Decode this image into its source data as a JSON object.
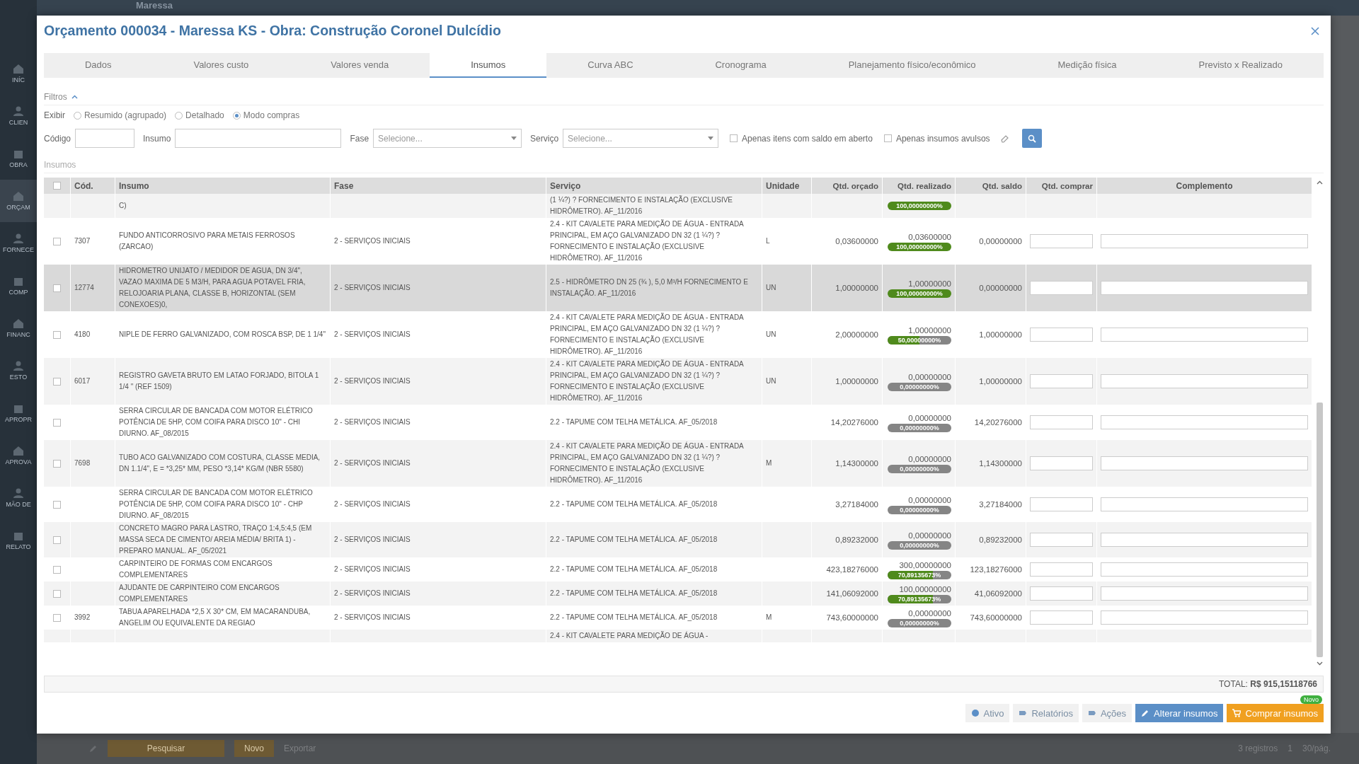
{
  "background": {
    "brand": "Maressa",
    "sidebar_items": [
      {
        "label": "INÍC",
        "selected": false
      },
      {
        "label": "CLIEN",
        "selected": false
      },
      {
        "label": "OBRA",
        "selected": false
      },
      {
        "label": "ORÇAM",
        "selected": true
      },
      {
        "label": "FORNECE",
        "selected": false
      },
      {
        "label": "COMP",
        "selected": false
      },
      {
        "label": "FINANC",
        "selected": false
      },
      {
        "label": "ESTO",
        "selected": false
      },
      {
        "label": "APROPR",
        "selected": false
      },
      {
        "label": "APROVA",
        "selected": false
      },
      {
        "label": "MÃO DE",
        "selected": false
      },
      {
        "label": "RELATO",
        "selected": false
      }
    ],
    "bottom_bar": {
      "search_button": "Pesquisar",
      "new_button": "Novo",
      "export_link": "Exportar",
      "record_count": "3 registros",
      "page": "1",
      "page_size": "30/pág."
    }
  },
  "window": {
    "title": "Orçamento 000034 - Maressa KS - Obra: Construção Coronel Dulcídio"
  },
  "tabs": [
    {
      "label": "Dados",
      "selected": false
    },
    {
      "label": "Valores custo",
      "selected": false
    },
    {
      "label": "Valores venda",
      "selected": false
    },
    {
      "label": "Insumos",
      "selected": true
    },
    {
      "label": "Curva ABC",
      "selected": false
    },
    {
      "label": "Cronograma",
      "selected": false
    },
    {
      "label": "Planejamento físico/econômico",
      "selected": false
    },
    {
      "label": "Medição física",
      "selected": false
    },
    {
      "label": "Previsto x Realizado",
      "selected": false
    }
  ],
  "filters": {
    "title": "Filtros",
    "expanded": true,
    "display": {
      "label": "Exibir",
      "options": [
        {
          "label": "Resumido (agrupado)",
          "selected": false
        },
        {
          "label": "Detalhado",
          "selected": false
        },
        {
          "label": "Modo compras",
          "selected": true
        }
      ]
    },
    "fields": [
      {
        "kind": "text",
        "label": "Código"
      },
      {
        "kind": "text",
        "label": "Insumo"
      },
      {
        "kind": "select",
        "label": "Fase",
        "placeholder": "Selecione..."
      },
      {
        "kind": "select",
        "label": "Serviço",
        "placeholder": "Selecione..."
      },
      {
        "kind": "checkbox",
        "label": "Apenas itens com saldo em aberto",
        "checked": false
      },
      {
        "kind": "checkbox",
        "label": "Apenas insumos avulsos",
        "checked": false
      }
    ]
  },
  "section_label": "Insumos",
  "table": {
    "select_all": false,
    "columns": [
      "Cód.",
      "Insumo",
      "Fase",
      "Serviço",
      "Unidade",
      "Qtd. orçado",
      "Qtd. realizado",
      "Qtd. saldo",
      "Qtd. comprar",
      "Complemento"
    ],
    "rows": [
      {
        "kind": "partial",
        "selected": false,
        "insumo": "C)",
        "servico": "(1 ¼?) ? FORNECIMENTO E INSTALAÇÃO (EXCLUSIVE HIDRÔMETRO). AF_11/2016",
        "level": 1,
        "percent": "100,00000000%"
      },
      {
        "kind": "full",
        "selected": false,
        "checked": false,
        "code": "7307",
        "insumo": "FUNDO ANTICORROSIVO PARA METAIS FERROSOS (ZARCAO)",
        "fase": "2 - SERVIÇOS INICIAIS",
        "servico": "2.4 - KIT CAVALETE PARA MEDIÇÃO DE ÁGUA - ENTRADA PRINCIPAL, EM AÇO GALVANIZADO DN 32 (1 ¼?) ? FORNECIMENTO E INSTALAÇÃO (EXCLUSIVE HIDRÔMETRO). AF_11/2016",
        "unidade": "L",
        "orcado": "0,03600000",
        "realizado": "0,03600000",
        "level": 1,
        "percent": "100,00000000%",
        "saldo": "0,00000000"
      },
      {
        "kind": "full",
        "selected": true,
        "checked": false,
        "code": "12774",
        "insumo": "HIDROMETRO UNIJATO / MEDIDOR DE AGUA, DN 3/4\", VAZAO MAXIMA DE 5 M3/H, PARA AGUA POTAVEL FRIA, RELOJOARIA PLANA, CLASSE B, HORIZONTAL (SEM CONEXOES)0,",
        "fase": "2 - SERVIÇOS INICIAIS",
        "servico": "2.5 - HIDRÔMETRO DN 25 (¾ ), 5,0 M³/H FORNECIMENTO E INSTALAÇÃO. AF_11/2016",
        "unidade": "UN",
        "orcado": "1,00000000",
        "realizado": "1,00000000",
        "level": 1,
        "percent": "100,00000000%",
        "saldo": "0,00000000"
      },
      {
        "kind": "full",
        "selected": false,
        "checked": false,
        "code": "4180",
        "insumo": "NIPLE DE FERRO GALVANIZADO, COM ROSCA BSP, DE 1 1/4\"",
        "fase": "2 - SERVIÇOS INICIAIS",
        "servico": "2.4 - KIT CAVALETE PARA MEDIÇÃO DE ÁGUA - ENTRADA PRINCIPAL, EM AÇO GALVANIZADO DN 32 (1 ¼?) ? FORNECIMENTO E INSTALAÇÃO (EXCLUSIVE HIDRÔMETRO). AF_11/2016",
        "unidade": "UN",
        "orcado": "2,00000000",
        "realizado": "1,00000000",
        "level": 0.5,
        "percent": "50,00000000%",
        "saldo": "1,00000000"
      },
      {
        "kind": "full",
        "selected": false,
        "checked": false,
        "code": "6017",
        "insumo": "REGISTRO GAVETA BRUTO EM LATAO FORJADO, BITOLA 1 1/4 \" (REF 1509)",
        "fase": "2 - SERVIÇOS INICIAIS",
        "servico": "2.4 - KIT CAVALETE PARA MEDIÇÃO DE ÁGUA - ENTRADA PRINCIPAL, EM AÇO GALVANIZADO DN 32 (1 ¼?) ? FORNECIMENTO E INSTALAÇÃO (EXCLUSIVE HIDRÔMETRO). AF_11/2016",
        "unidade": "UN",
        "orcado": "1,00000000",
        "realizado": "0,00000000",
        "level": 0,
        "percent": "0,00000000%",
        "saldo": "1,00000000"
      },
      {
        "kind": "full",
        "selected": false,
        "checked": false,
        "insumo": "SERRA CIRCULAR DE BANCADA COM MOTOR ELÉTRICO POTÊNCIA DE 5HP, COM COIFA PARA DISCO 10\" - CHI DIURNO. AF_08/2015",
        "fase": "2 - SERVIÇOS INICIAIS",
        "servico": "2.2 - TAPUME COM TELHA METÁLICA. AF_05/2018",
        "orcado": "14,20276000",
        "realizado": "0,00000000",
        "level": 0,
        "percent": "0,00000000%",
        "saldo": "14,20276000"
      },
      {
        "kind": "full",
        "selected": false,
        "checked": false,
        "code": "7698",
        "insumo": "TUBO ACO GALVANIZADO COM COSTURA, CLASSE MEDIA, DN 1.1/4\", E = *3,25* MM, PESO *3,14* KG/M (NBR 5580)",
        "fase": "2 - SERVIÇOS INICIAIS",
        "servico": "2.4 - KIT CAVALETE PARA MEDIÇÃO DE ÁGUA - ENTRADA PRINCIPAL, EM AÇO GALVANIZADO DN 32 (1 ¼?) ? FORNECIMENTO E INSTALAÇÃO (EXCLUSIVE HIDRÔMETRO). AF_11/2016",
        "unidade": "M",
        "orcado": "1,14300000",
        "realizado": "0,00000000",
        "level": 0,
        "percent": "0,00000000%",
        "saldo": "1,14300000"
      },
      {
        "kind": "full",
        "selected": false,
        "checked": false,
        "insumo": "SERRA CIRCULAR DE BANCADA COM MOTOR ELÉTRICO POTÊNCIA DE 5HP, COM COIFA PARA DISCO 10\" - CHP DIURNO. AF_08/2015",
        "fase": "2 - SERVIÇOS INICIAIS",
        "servico": "2.2 - TAPUME COM TELHA METÁLICA. AF_05/2018",
        "orcado": "3,27184000",
        "realizado": "0,00000000",
        "level": 0,
        "percent": "0,00000000%",
        "saldo": "3,27184000"
      },
      {
        "kind": "full",
        "selected": false,
        "checked": false,
        "insumo": "CONCRETO MAGRO PARA LASTRO, TRAÇO 1:4,5:4,5 (EM MASSA SECA DE CIMENTO/ AREIA MÉDIA/ BRITA 1) - PREPARO MANUAL. AF_05/2021",
        "fase": "2 - SERVIÇOS INICIAIS",
        "servico": "2.2 - TAPUME COM TELHA METÁLICA. AF_05/2018",
        "orcado": "0,89232000",
        "realizado": "0,00000000",
        "level": 0,
        "percent": "0,00000000%",
        "saldo": "0,89232000"
      },
      {
        "kind": "full",
        "selected": false,
        "checked": false,
        "insumo": "CARPINTEIRO DE FORMAS COM ENCARGOS COMPLEMENTARES",
        "fase": "2 - SERVIÇOS INICIAIS",
        "servico": "2.2 - TAPUME COM TELHA METÁLICA. AF_05/2018",
        "orcado": "423,18276000",
        "realizado": "300,00000000",
        "level": 0.7089,
        "percent": "70,89135673%",
        "saldo": "123,18276000"
      },
      {
        "kind": "full",
        "selected": false,
        "checked": false,
        "insumo": "AJUDANTE DE CARPINTEIRO COM ENCARGOS COMPLEMENTARES",
        "fase": "2 - SERVIÇOS INICIAIS",
        "servico": "2.2 - TAPUME COM TELHA METÁLICA. AF_05/2018",
        "orcado": "141,06092000",
        "realizado": "100,00000000",
        "level": 0.7089,
        "percent": "70,89135673%",
        "saldo": "41,06092000"
      },
      {
        "kind": "full",
        "selected": false,
        "checked": false,
        "code": "3992",
        "insumo": "TABUA APARELHADA *2,5 X 30* CM, EM MACARANDUBA, ANGELIM OU EQUIVALENTE DA REGIAO",
        "fase": "2 - SERVIÇOS INICIAIS",
        "servico": "2.2 - TAPUME COM TELHA METÁLICA. AF_05/2018",
        "unidade": "M",
        "orcado": "743,60000000",
        "realizado": "0,00000000",
        "level": 0,
        "percent": "0,00000000%",
        "saldo": "743,60000000"
      },
      {
        "kind": "partial",
        "selected": false,
        "servico": "2.4 - KIT CAVALETE PARA MEDIÇÃO DE ÁGUA -"
      }
    ],
    "total": "TOTAL: **R$ 915,15118766**"
  },
  "actions": [
    {
      "kind": "status",
      "label": "Ativo"
    },
    {
      "kind": "reports",
      "label": "Relatórios"
    },
    {
      "kind": "menu",
      "label": "Ações"
    },
    {
      "kind": "primary",
      "label": "Alterar insumos"
    },
    {
      "kind": "warning",
      "label": "Comprar insumos",
      "badge": "Novo"
    }
  ]
}
